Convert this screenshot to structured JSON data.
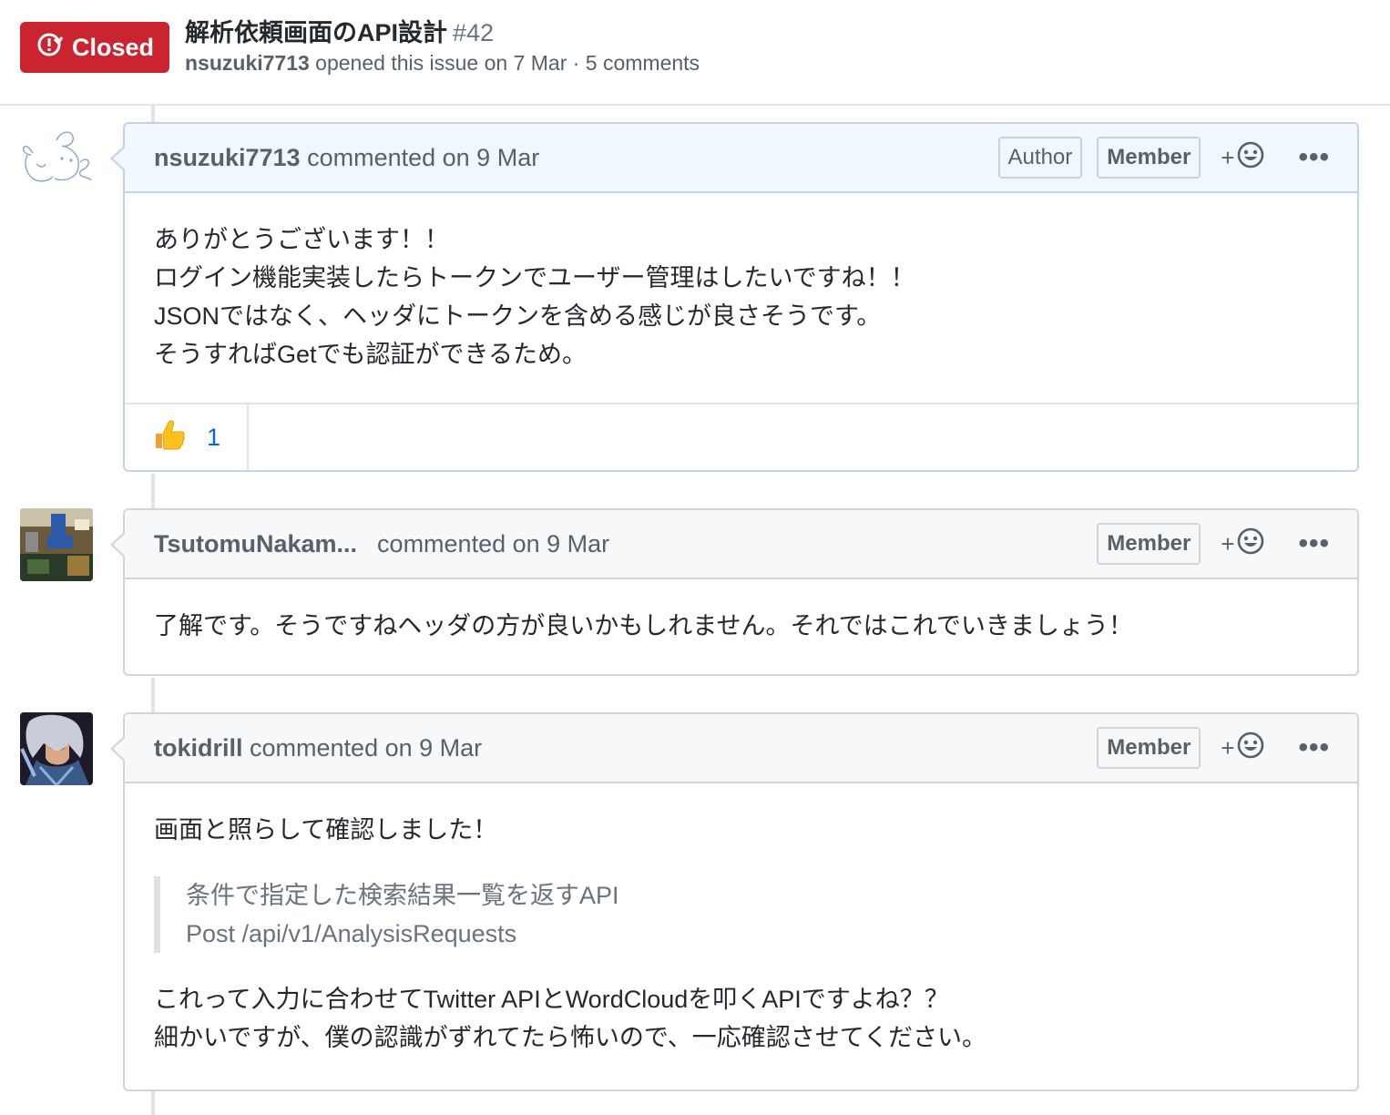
{
  "issue": {
    "state": "Closed",
    "title": "解析依頼画面のAPI設計",
    "number": "#42",
    "author": "nsuzuki7713",
    "meta_text": " opened this issue on 7 Mar · 5 comments"
  },
  "comments": [
    {
      "author": "nsuzuki7713",
      "action": " commented on 9 Mar",
      "labels": [
        "Author",
        "Member"
      ],
      "reaction_button": "+",
      "more": "•••",
      "body": [
        "ありがとうございます！！",
        "ログイン機能実装したらトークンでユーザー管理はしたいですね！！",
        "JSONではなく、ヘッダにトークンを含める感じが良さそうです。",
        "そうすればGetでも認証ができるため。"
      ],
      "reactions": [
        {
          "icon": "thumbs-up-icon",
          "count": "1"
        }
      ]
    },
    {
      "author": "TsutomuNakam...",
      "action": "commented on 9 Mar",
      "labels": [
        "Member"
      ],
      "reaction_button": "+",
      "more": "•••",
      "body": [
        "了解です。そうですねヘッダの方が良いかもしれません。それではこれでいきましょう！"
      ]
    },
    {
      "author": "tokidrill",
      "action": " commented on 9 Mar",
      "labels": [
        "Member"
      ],
      "reaction_button": "+",
      "more": "•••",
      "body_intro": "画面と照らして確認しました！",
      "quote": [
        "条件で指定した検索結果一覧を返すAPI",
        "Post /api/v1/AnalysisRequests"
      ],
      "body": [
        "これって入力に合わせてTwitter APIとWordCloudを叩くAPIですよね？？",
        "細かいですが、僕の認識がずれてたら怖いので、一応確認させてください。"
      ]
    }
  ],
  "colors": {
    "closed_red": "#cb2431",
    "own_comment_header": "#f1f8ff",
    "comment_header": "#f6f8fa",
    "link_blue": "#0366d6"
  }
}
